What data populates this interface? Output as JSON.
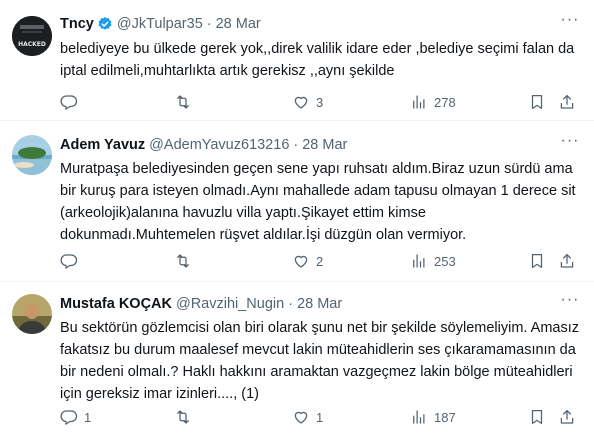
{
  "tweets": [
    {
      "name": "Tncy",
      "handle": "@JkTulpar35",
      "dot": "·",
      "time": "28 Mar",
      "text": "belediyeye bu ülkede gerek yok,,direk valilik idare eder ,belediye seçimi falan da iptal edilmeli,muhtarlıkta artık gerekisz ,,aynı şekilde",
      "avatar_text": "HACKED",
      "replies": "",
      "retweets": "",
      "likes": "3",
      "views": "278"
    },
    {
      "name": "Adem Yavuz",
      "handle": "@AdemYavuz613216",
      "dot": "·",
      "time": "28 Mar",
      "text": "Muratpaşa belediyesinden geçen sene yapı ruhsatı aldım.Biraz uzun sürdü ama bir kuruş para isteyen olmadı.Aynı mahallede adam tapusu olmayan 1 derece sit (arkeolojik)alanına havuzlu villa yaptı.Şikayet ettim kimse dokunmadı.Muhtemelen rüşvet aldılar.İşi düzgün olan vermiyor.",
      "replies": "",
      "retweets": "",
      "likes": "2",
      "views": "253"
    },
    {
      "name": "Mustafa KOÇAK",
      "handle": "@Ravzihi_Nugin",
      "dot": "·",
      "time": "28 Mar",
      "text": "Bu sektörün gözlemcisi olan biri olarak şunu net bir şekilde söylemeliyim. Amasız fakatsız bu durum maalesef mevcut lakin müteahidlerin ses çıkaramamasının da bir nedeni olmalı.? Haklı hakkını aramaktan vazgeçmez lakin bölge müteahidleri için gereksiz imar izinleri...., (1)",
      "replies": "1",
      "retweets": "",
      "likes": "1",
      "views": "187"
    }
  ],
  "colors": {
    "text": "#0f1419",
    "secondary": "#536471",
    "verified": "#1d9bf0",
    "divider": "#eff3f4"
  },
  "icons": [
    "verified-badge-icon",
    "more-icon",
    "reply-icon",
    "retweet-icon",
    "like-icon",
    "views-icon",
    "bookmark-icon",
    "share-icon"
  ]
}
